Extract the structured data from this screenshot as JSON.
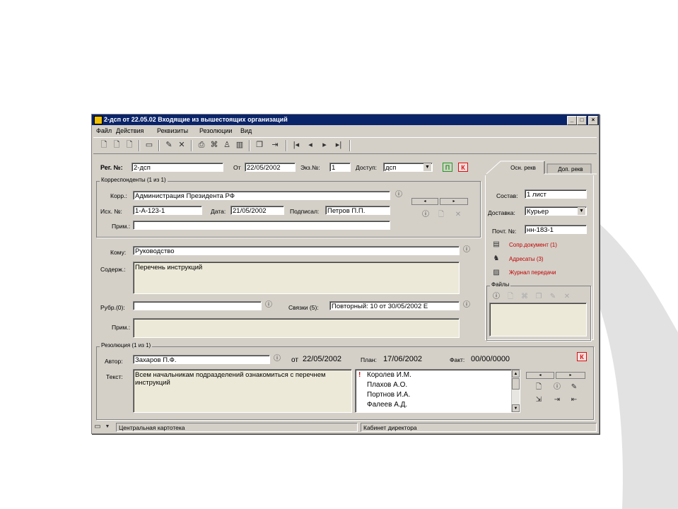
{
  "window": {
    "title": "2-дсп от 22.05.02 Входящие из вышестоящих организаций",
    "controls": [
      "_",
      "□",
      "×"
    ]
  },
  "menu": [
    "Файл",
    "Действия",
    "Реквизиты",
    "Резолюции",
    "Вид"
  ],
  "toolbar": {
    "icons": [
      "new-doc-icon",
      "new-doc-copy-icon",
      "new-doc-template-icon",
      "save-icon",
      "edit-icon",
      "delete-icon",
      "print-icon",
      "scan-icon",
      "user-icon",
      "barcode-icon",
      "copy-icon",
      "send-icon",
      "first-icon",
      "prev-icon",
      "next-icon",
      "last-icon"
    ]
  },
  "header": {
    "reg_label": "Рег. №:",
    "reg_value": "2-дсп",
    "from_label": "От",
    "from_value": "22/05/2002",
    "copy_label": "Экз.№:",
    "copy_value": "1",
    "access_label": "Доступ:",
    "access_value": "дсп",
    "btn_p": "П",
    "btn_k": "К"
  },
  "correspondents": {
    "caption": "Корреспонденты (1 из 1)",
    "corr_label": "Корр.:",
    "corr_value": "Администрация Президента РФ",
    "out_label": "Исх. №:",
    "out_value": "1-А-123-1",
    "date_label": "Дата:",
    "date_value": "21/05/2002",
    "signed_label": "Подписал:",
    "signed_value": "Петров П.П.",
    "note_label": "Прим.:",
    "note_value": ""
  },
  "main": {
    "to_label": "Кому:",
    "to_value": "Руководство",
    "content_label": "Содерж.:",
    "content_value": "Перечень инструкций",
    "rubric_label": "Рубр.(0):",
    "rubric_value": "",
    "links_label": "Связки (5):",
    "links_value": "Повторный: 10 от 30/05/2002 Е",
    "note_label": "Прим.:",
    "note_value": ""
  },
  "tabs": {
    "main": "Осн. рекв",
    "extra": "Доп. рекв"
  },
  "side": {
    "composition_label": "Состав:",
    "composition_value": "1 лист",
    "delivery_label": "Доставка:",
    "delivery_value": "Курьер",
    "postal_label": "Почт. №:",
    "postal_value": "нн-183-1",
    "link_docs": "Сопр.документ (1)",
    "link_addressees": "Адресаты (3)",
    "link_journal": "Журнал передачи",
    "files_caption": "Файлы"
  },
  "resolution": {
    "caption": "Резолюция (1 из 1)",
    "author_label": "Автор:",
    "author_value": "Захаров П.Ф.",
    "from_label": "от",
    "from_value": "22/05/2002",
    "plan_label": "План:",
    "plan_value": "17/06/2002",
    "fact_label": "Факт:",
    "fact_value": "00/00/0000",
    "btn_k": "К",
    "text_label": "Текст:",
    "text_value": "Всем начальникам подразделений ознакомиться с перечнем инструкций",
    "executors": [
      "Королев И.М.",
      "Плахов А.О.",
      "Портнов И.А.",
      "Фалеев А.Д."
    ],
    "mark": "!"
  },
  "statusbar": {
    "left": "Центральная картотека",
    "right": "Кабинет директора"
  },
  "colors": {
    "titlebar": "#0a246a",
    "window": "#d4d0c8",
    "btn_p": "#1f9b1f",
    "btn_k": "#d01010",
    "link": "#c00000"
  }
}
